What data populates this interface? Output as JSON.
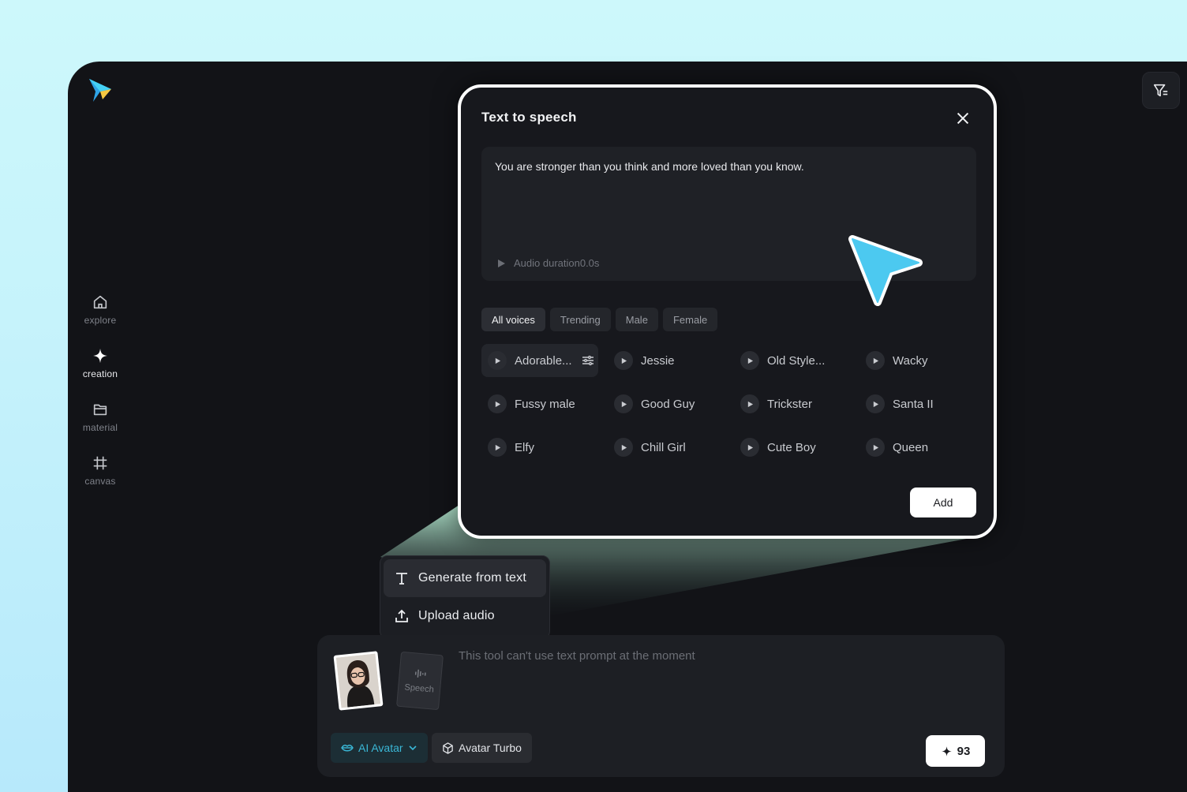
{
  "colors": {
    "accent": "#3ab7d6",
    "background": "#121317",
    "cursor": "#4cc9f0"
  },
  "sidebar": {
    "items": [
      {
        "label": "explore",
        "icon": "home-icon"
      },
      {
        "label": "creation",
        "icon": "sparkle-icon",
        "active": true
      },
      {
        "label": "material",
        "icon": "folder-icon"
      },
      {
        "label": "canvas",
        "icon": "frame-icon"
      }
    ]
  },
  "dialog": {
    "title": "Text to speech",
    "text": "You are stronger than you think and more loved than you know.",
    "audio_duration": "Audio duration0.0s",
    "filters": [
      "All voices",
      "Trending",
      "Male",
      "Female"
    ],
    "voices": [
      "Adorable...",
      "Jessie",
      "Old Style...",
      "Wacky",
      "Fussy male",
      "Good Guy",
      "Trickster",
      "Santa II",
      "Elfy",
      "Chill Girl",
      "Cute Boy",
      "Queen"
    ],
    "add_label": "Add"
  },
  "menu": {
    "generate_label": "Generate from text",
    "upload_label": "Upload audio"
  },
  "panel": {
    "speech_label": "Speech",
    "placeholder": "This tool can't use text prompt at the moment",
    "ai_avatar_label": "AI Avatar",
    "turbo_label": "Avatar Turbo",
    "credits": "93"
  }
}
